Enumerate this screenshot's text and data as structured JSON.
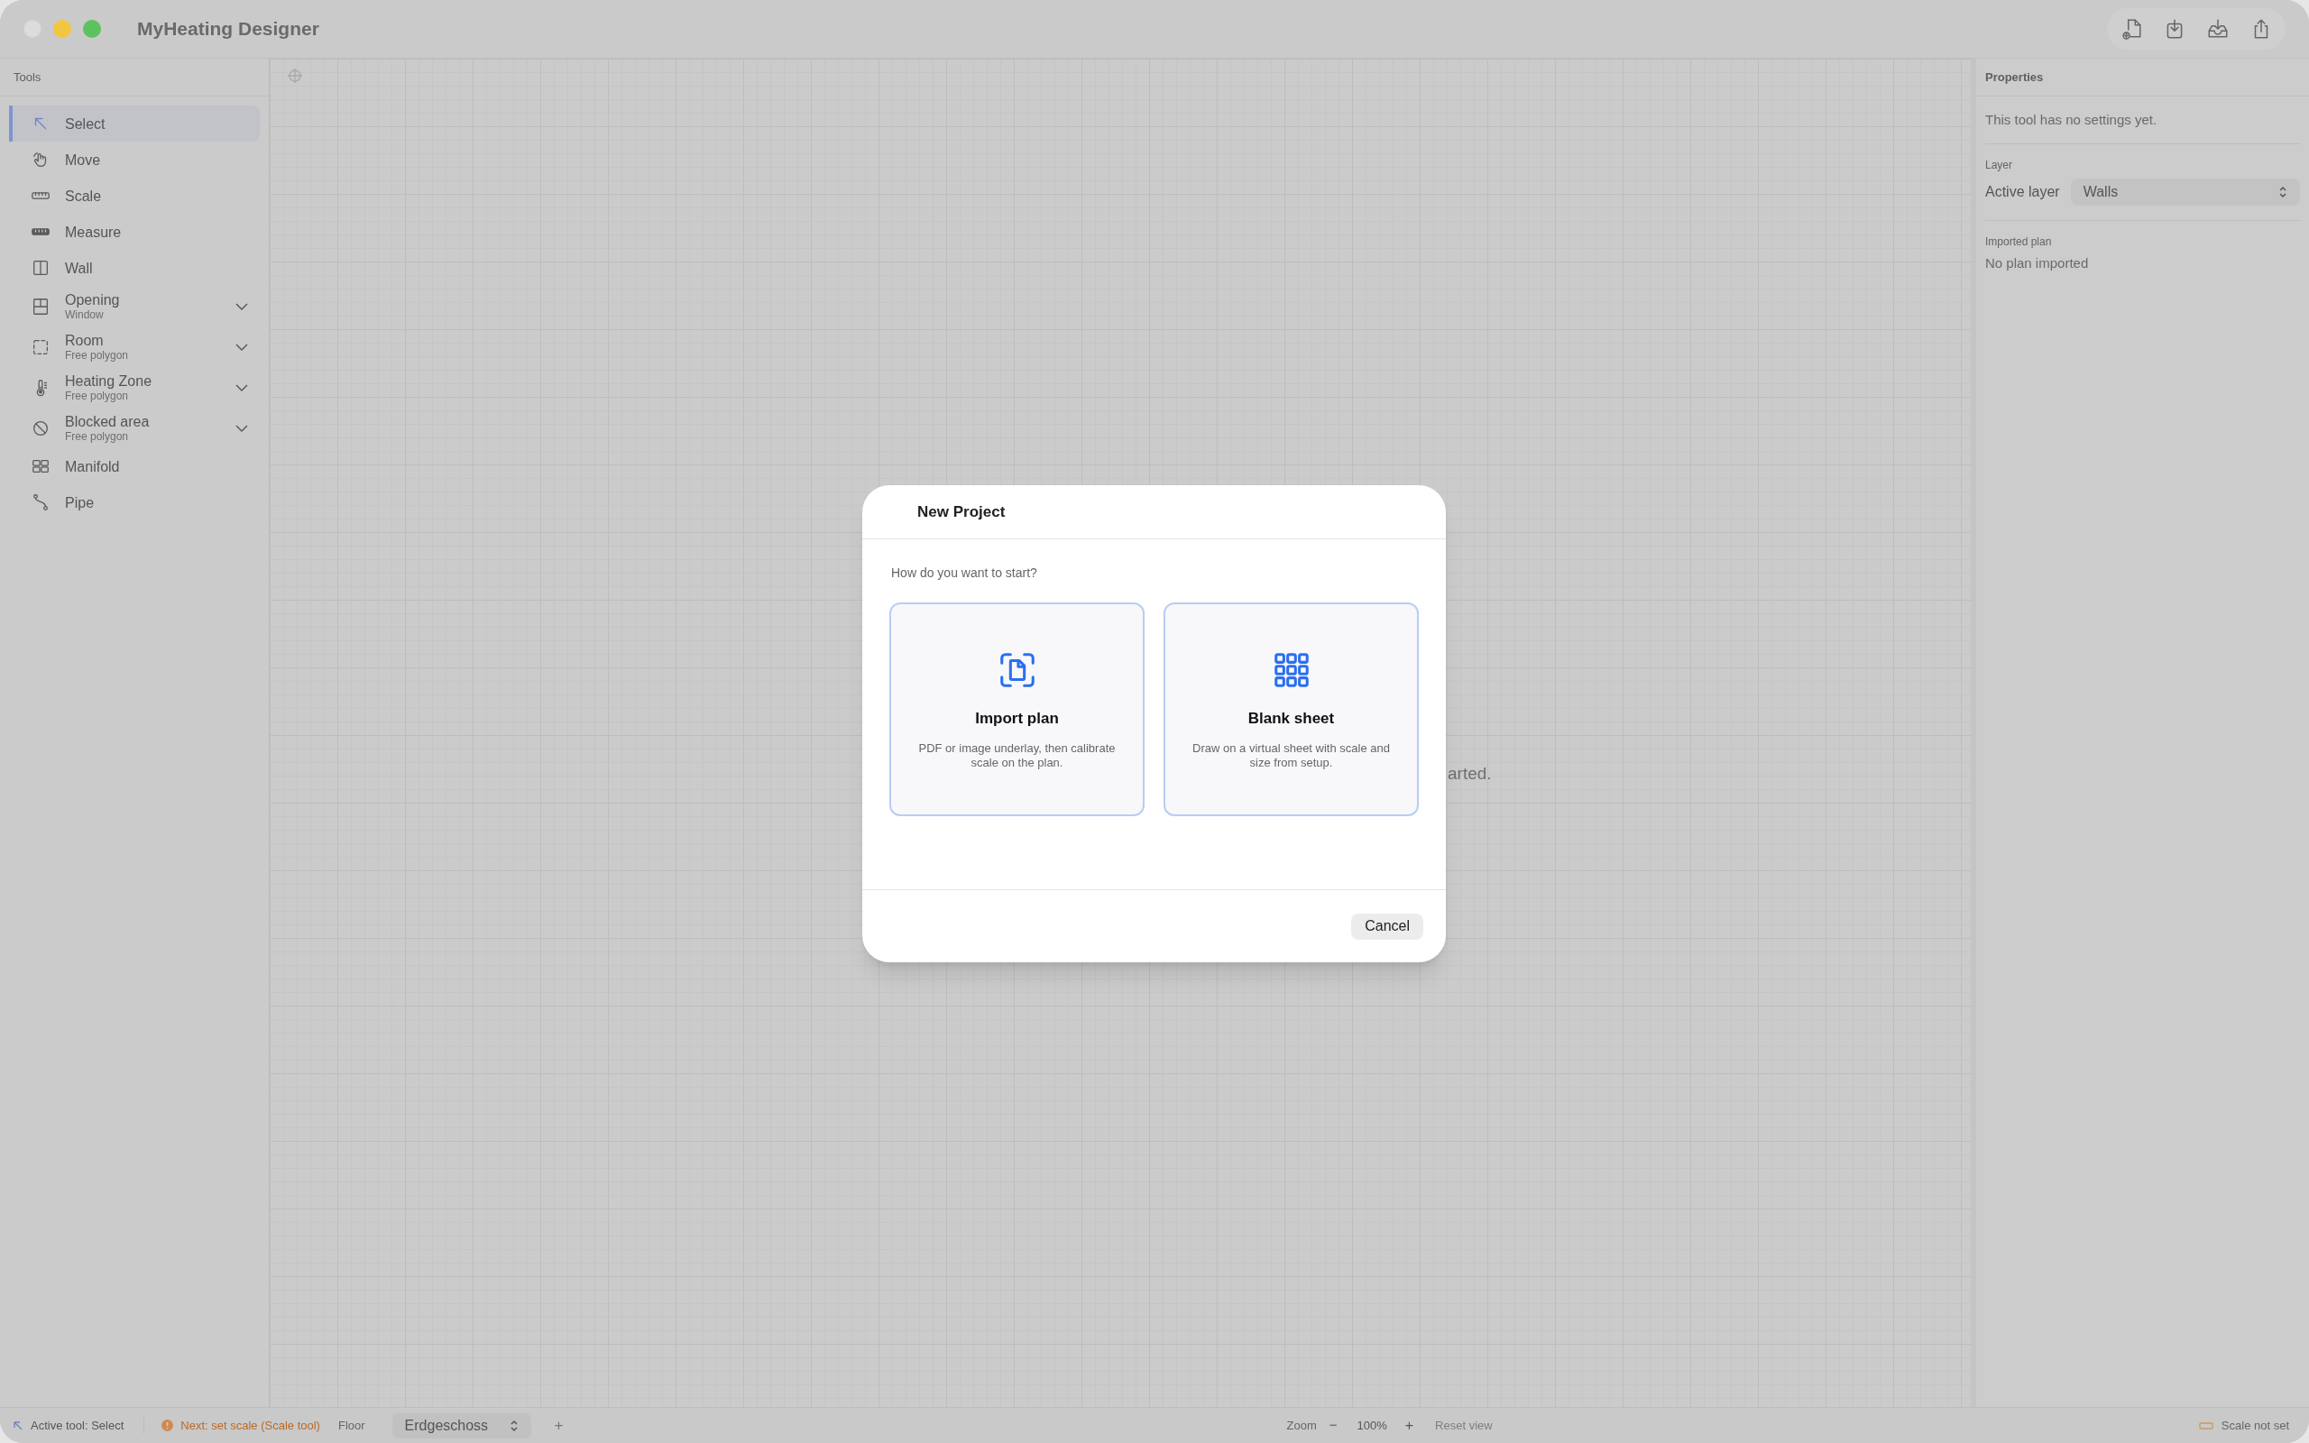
{
  "window": {
    "title": "MyHeating Designer"
  },
  "sidebar": {
    "title": "Tools",
    "tools": [
      {
        "label": "Select",
        "selected": true,
        "expandable": false
      },
      {
        "label": "Move",
        "selected": false,
        "expandable": false
      },
      {
        "label": "Scale",
        "selected": false,
        "expandable": false
      },
      {
        "label": "Measure",
        "selected": false,
        "expandable": false
      },
      {
        "label": "Wall",
        "selected": false,
        "expandable": false
      },
      {
        "label": "Opening",
        "sublabel": "Window",
        "selected": false,
        "expandable": true
      },
      {
        "label": "Room",
        "sublabel": "Free polygon",
        "selected": false,
        "expandable": true
      },
      {
        "label": "Heating Zone",
        "sublabel": "Free polygon",
        "selected": false,
        "expandable": true
      },
      {
        "label": "Blocked area",
        "sublabel": "Free polygon",
        "selected": false,
        "expandable": true
      },
      {
        "label": "Manifold",
        "selected": false,
        "expandable": false
      },
      {
        "label": "Pipe",
        "selected": false,
        "expandable": false
      }
    ]
  },
  "canvas": {
    "hint": "arted."
  },
  "properties": {
    "title": "Properties",
    "note": "This tool has no settings yet.",
    "layer_section": "Layer",
    "active_layer_label": "Active layer",
    "active_layer_value": "Walls",
    "imported_section": "Imported plan",
    "imported_value": "No plan imported"
  },
  "status_bar": {
    "active_tool": "Active tool: Select",
    "next_step": "Next: set scale (Scale tool)",
    "floor_label": "Floor",
    "floor_value": "Erdgeschoss",
    "add_floor": "+",
    "zoom_label": "Zoom",
    "zoom_out": "−",
    "zoom_value": "100%",
    "zoom_in": "+",
    "reset_view": "Reset view",
    "reset_disabled": true,
    "scale_status": "Scale not set"
  },
  "dialog": {
    "title": "New Project",
    "prompt": "How do you want to start?",
    "options": [
      {
        "title": "Import plan",
        "description": "PDF or image underlay, then calibrate scale on the plan."
      },
      {
        "title": "Blank sheet",
        "description": "Draw on a virtual sheet with scale and size from setup."
      }
    ],
    "cancel": "Cancel"
  }
}
